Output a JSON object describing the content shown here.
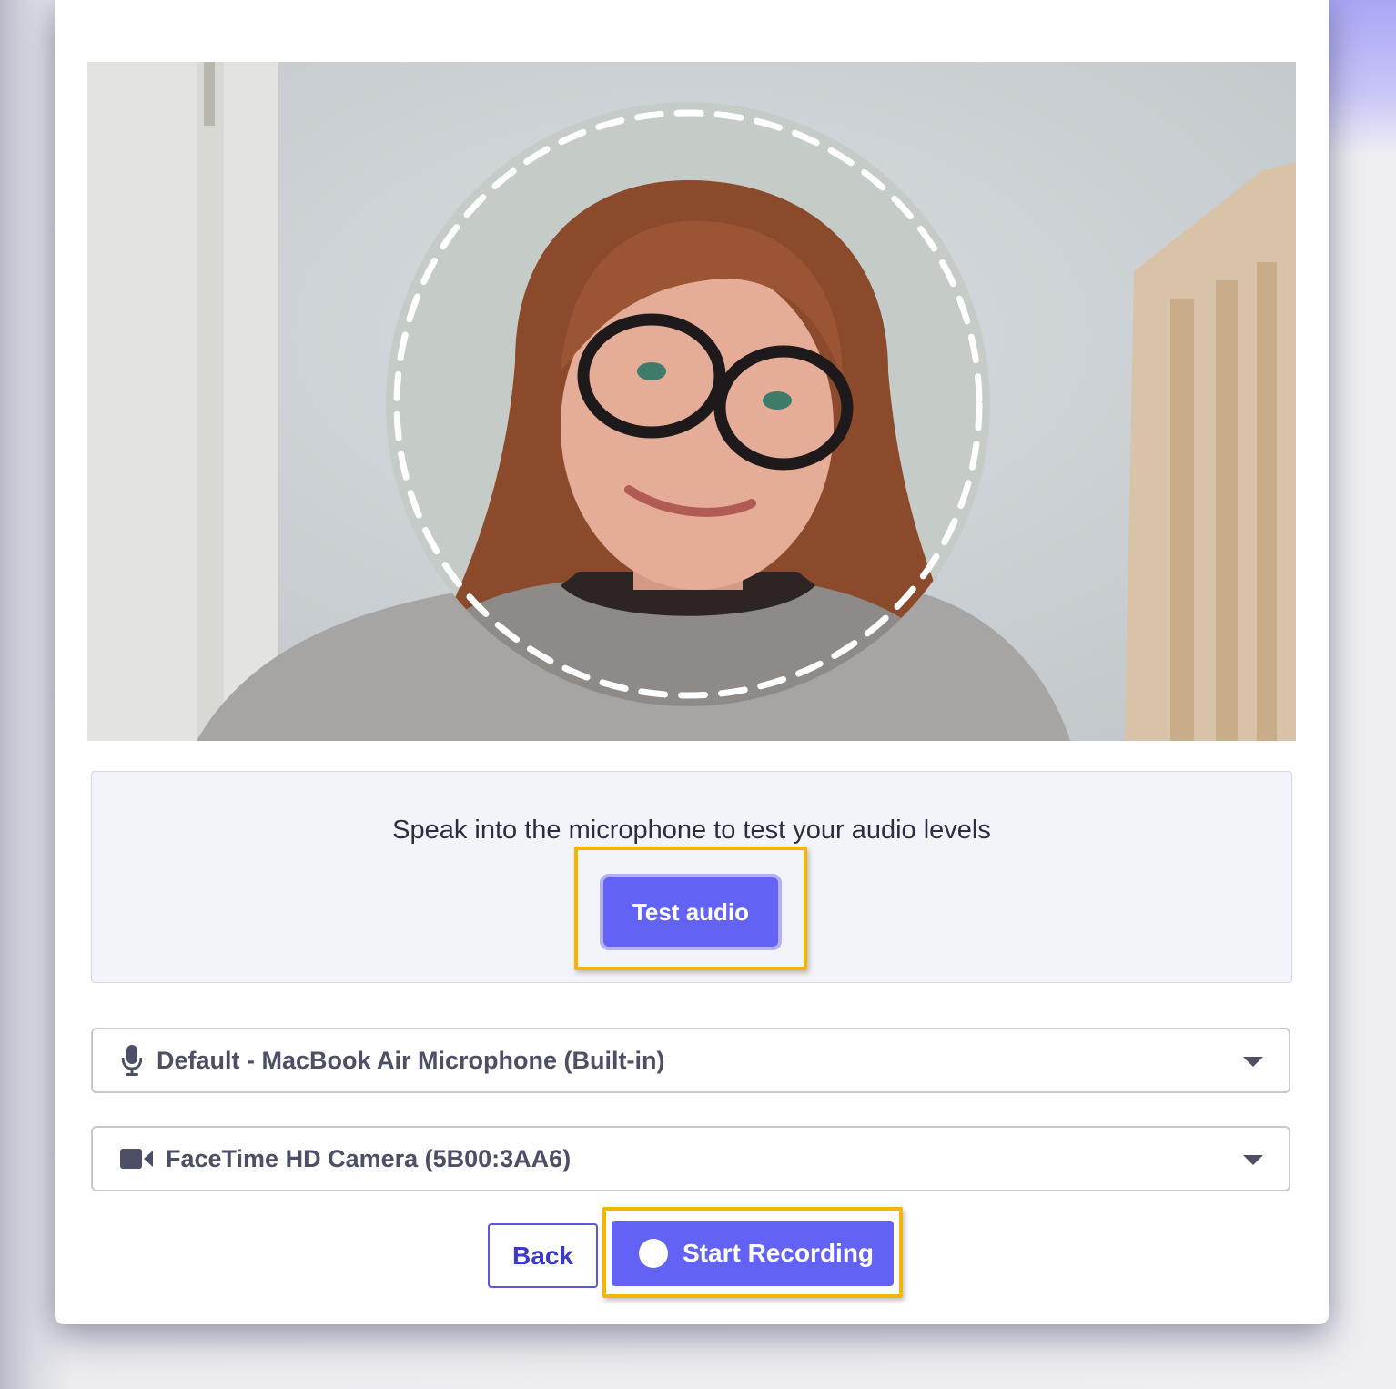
{
  "audio_test": {
    "hint": "Speak into the microphone to test your audio levels",
    "button_label": "Test audio"
  },
  "microphone_select": {
    "icon": "microphone-icon",
    "selected": "Default - MacBook Air Microphone (Built-in)"
  },
  "camera_select": {
    "icon": "video-camera-icon",
    "selected": "FaceTime HD Camera (5B00:3AA6)"
  },
  "actions": {
    "back_label": "Back",
    "record_label": "Start Recording"
  },
  "colors": {
    "accent": "#6262f5",
    "highlight": "#f5b400",
    "panel_bg": "#f3f4f9"
  }
}
